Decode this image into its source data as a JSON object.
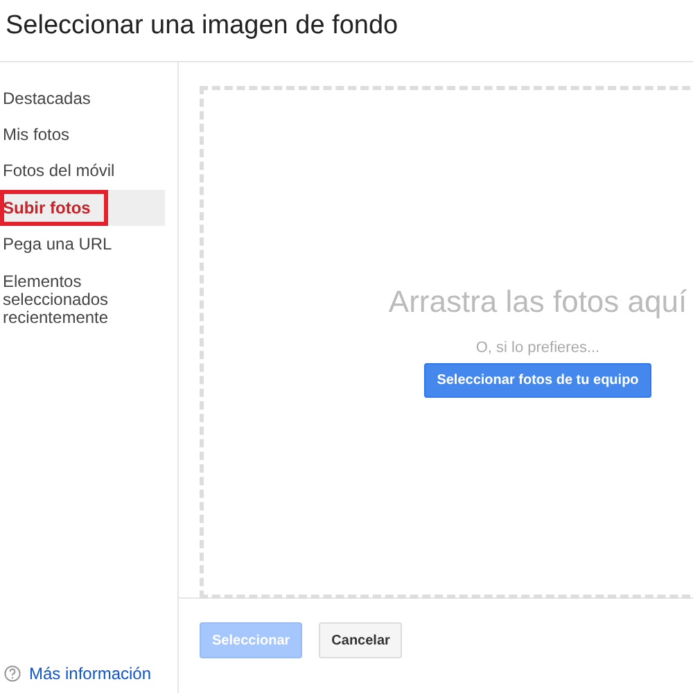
{
  "dialog": {
    "title": "Seleccionar una imagen de fondo"
  },
  "sidebar": {
    "items": [
      {
        "label": "Destacadas",
        "selected": false,
        "highlighted": false
      },
      {
        "label": "Mis fotos",
        "selected": false,
        "highlighted": false
      },
      {
        "label": "Fotos del móvil",
        "selected": false,
        "highlighted": false
      },
      {
        "label": "Subir fotos",
        "selected": true,
        "highlighted": true
      },
      {
        "label": "Pega una URL",
        "selected": false,
        "highlighted": false
      },
      {
        "label": "Elementos seleccionados recientemente",
        "selected": false,
        "highlighted": false
      }
    ],
    "help_link": "Más información"
  },
  "drop_zone": {
    "heading": "Arrastra las fotos aquí",
    "alternative": "O, si lo prefieres...",
    "button": "Seleccionar fotos de tu equipo"
  },
  "footer": {
    "buttons": [
      {
        "label": "Seleccionar",
        "kind": "primary",
        "disabled": true
      },
      {
        "label": "Cancelar",
        "kind": "secondary",
        "disabled": false
      }
    ]
  }
}
